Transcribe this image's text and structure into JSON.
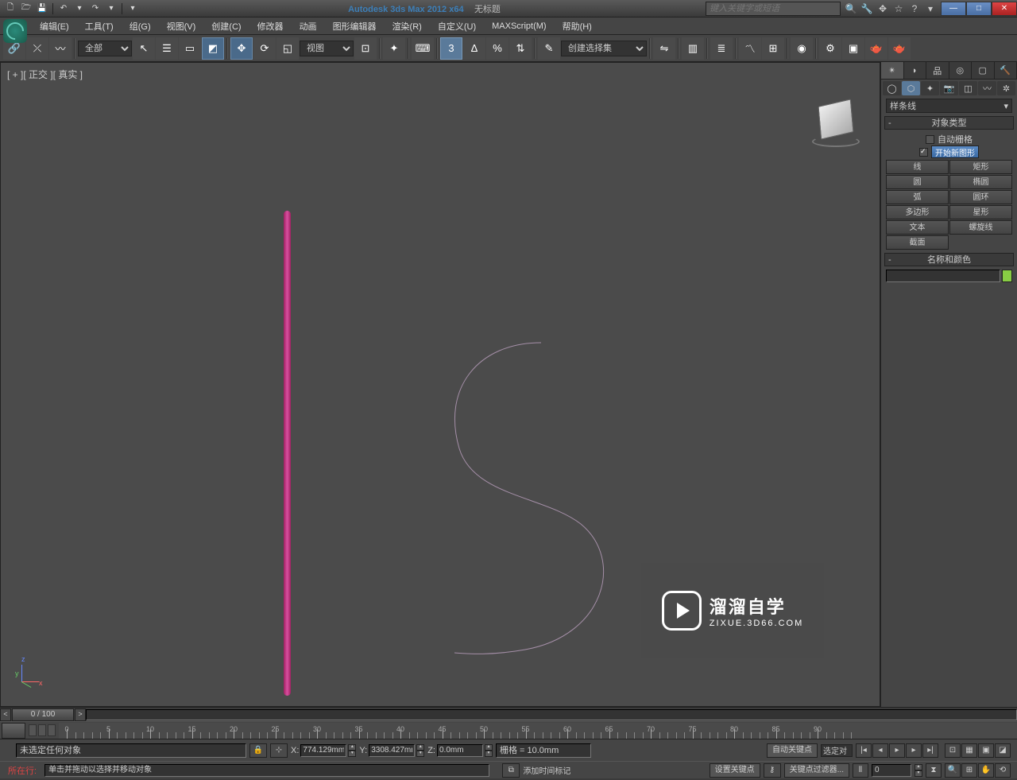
{
  "title": {
    "product": "Autodesk 3ds Max  2012 x64",
    "doc": "无标题"
  },
  "search_placeholder": "键入关键字或短语",
  "menu": [
    "编辑(E)",
    "工具(T)",
    "组(G)",
    "视图(V)",
    "创建(C)",
    "修改器",
    "动画",
    "图形编辑器",
    "渲染(R)",
    "自定义(U)",
    "MAXScript(M)",
    "帮助(H)"
  ],
  "toolbar": {
    "filter_all": "全部",
    "view_combo": "视图",
    "named_sel": "创建选择集",
    "snap_angle": "3"
  },
  "viewport_label": "[ + ][ 正交 ][ 真实  ]",
  "cmd": {
    "shape_type": "样条线",
    "rollout_objtype": "对象类型",
    "auto_grid": "自动栅格",
    "start_new": "开始新图形",
    "shapes": [
      [
        "线",
        "矩形"
      ],
      [
        "圆",
        "椭圆"
      ],
      [
        "弧",
        "圆环"
      ],
      [
        "多边形",
        "星形"
      ],
      [
        "文本",
        "螺旋线"
      ],
      [
        "截面",
        ""
      ]
    ],
    "rollout_namecolor": "名称和颜色"
  },
  "timeline": {
    "frame": "0 / 100",
    "ticks": [
      0,
      5,
      10,
      15,
      20,
      25,
      30,
      35,
      40,
      45,
      50,
      55,
      60,
      65,
      70,
      75,
      80,
      85,
      90
    ]
  },
  "status": {
    "sel_none": "未选定任何对象",
    "x": "774.129mm",
    "y": "3308.427mm",
    "z": "0.0mm",
    "grid": "栅格  =  10.0mm",
    "auto_key": "自动关键点",
    "sel_mode": "选定对",
    "set_key": "设置关键点",
    "key_filter": "关键点过滤器...",
    "prompt": "单击并拖动以选择并移动对象",
    "addtime": "添加时间标记",
    "cmdline": "所在行:",
    "frame_cur": "0"
  },
  "watermark": {
    "big": "溜溜自学",
    "small": "ZIXUE.3D66.COM"
  }
}
